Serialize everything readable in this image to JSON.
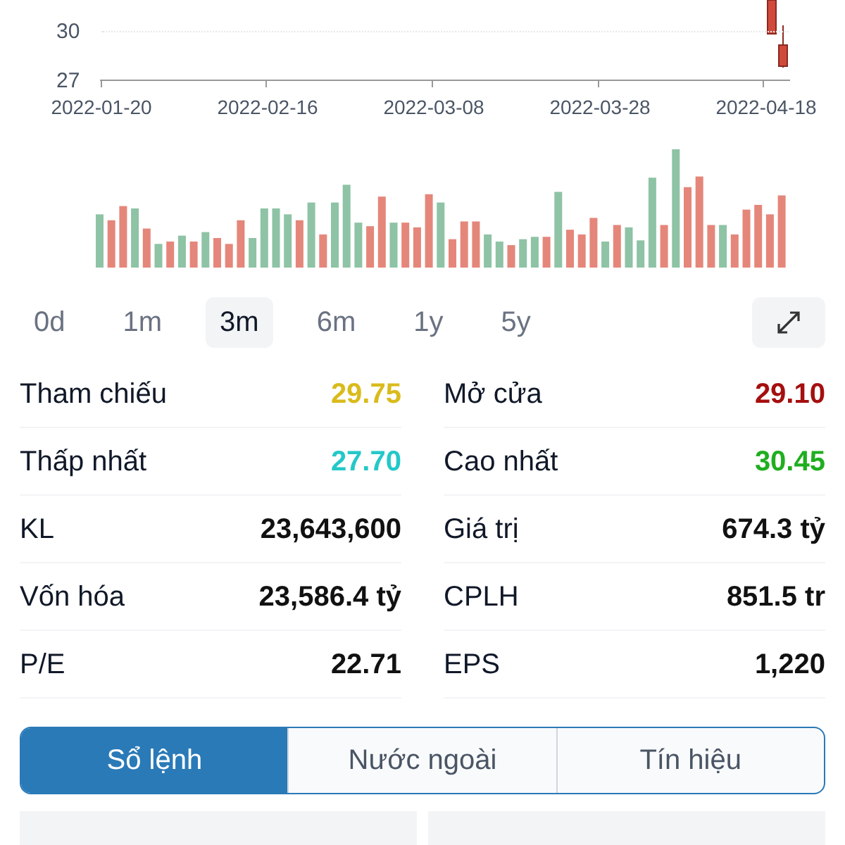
{
  "price_chart": {
    "y_ticks": [
      "30",
      "27"
    ],
    "x_ticks": [
      "2022-01-20",
      "2022-02-16",
      "2022-03-08",
      "2022-03-28",
      "2022-04-18"
    ]
  },
  "periods": [
    {
      "label": "0d",
      "selected": false
    },
    {
      "label": "1m",
      "selected": false
    },
    {
      "label": "3m",
      "selected": true
    },
    {
      "label": "6m",
      "selected": false
    },
    {
      "label": "1y",
      "selected": false
    },
    {
      "label": "5y",
      "selected": false
    }
  ],
  "stats": [
    [
      {
        "label": "Tham chiếu",
        "value": "29.75",
        "color": "#d9bb1c"
      },
      {
        "label": "Mở cửa",
        "value": "29.10",
        "color": "#a50f0f"
      }
    ],
    [
      {
        "label": "Thấp nhất",
        "value": "27.70",
        "color": "#24c8c8"
      },
      {
        "label": "Cao nhất",
        "value": "30.45",
        "color": "#1fae1f"
      }
    ],
    [
      {
        "label": "KL",
        "value": "23,643,600",
        "color": "#111111"
      },
      {
        "label": "Giá trị",
        "value": "674.3 tỷ",
        "color": "#111111"
      }
    ],
    [
      {
        "label": "Vốn hóa",
        "value": "23,586.4 tỷ",
        "color": "#111111"
      },
      {
        "label": "CPLH",
        "value": "851.5 tr",
        "color": "#111111"
      }
    ],
    [
      {
        "label": "P/E",
        "value": "22.71",
        "color": "#111111"
      },
      {
        "label": "EPS",
        "value": "1,220",
        "color": "#111111"
      }
    ]
  ],
  "tabs": [
    {
      "label": "Sổ lệnh",
      "selected": true
    },
    {
      "label": "Nước ngoài",
      "selected": false
    },
    {
      "label": "Tín hiệu",
      "selected": false
    }
  ]
}
